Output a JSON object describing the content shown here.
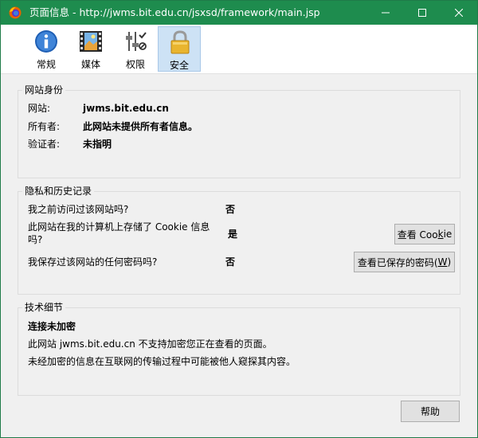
{
  "window": {
    "title": "页面信息 - http://jwms.bit.edu.cn/jsxsd/framework/main.jsp"
  },
  "tabs": [
    {
      "label": "常规",
      "icon": "info-icon"
    },
    {
      "label": "媒体",
      "icon": "media-icon"
    },
    {
      "label": "权限",
      "icon": "permissions-icon"
    },
    {
      "label": "安全",
      "icon": "lock-icon",
      "active": true
    }
  ],
  "identity": {
    "title": "网站身份",
    "site_label": "网站:",
    "site_value": "jwms.bit.edu.cn",
    "owner_label": "所有者:",
    "owner_value": "此网站未提供所有者信息。",
    "verifier_label": "验证者:",
    "verifier_value": "未指明"
  },
  "privacy": {
    "title": "隐私和历史记录",
    "q1": "我之前访问过该网站吗?",
    "a1": "否",
    "q2_line1": "此网站在我的计算机上存储了 Cookie 信息",
    "q2_line2": "吗?",
    "a2": "是",
    "q3": "我保存过该网站的任何密码吗?",
    "a3": "否",
    "cookie_button_text": "查看 Coo",
    "cookie_button_key": "k",
    "cookie_button_rest": "ie",
    "password_button_text": "查看已保存的密码(",
    "password_button_key": "W",
    "password_button_rest": ")"
  },
  "technical": {
    "title": "技术细节",
    "heading": "连接未加密",
    "line1": "此网站 jwms.bit.edu.cn 不支持加密您正在查看的页面。",
    "line2": "未经加密的信息在互联网的传输过程中可能被他人窥探其内容。"
  },
  "footer": {
    "help_label": "帮助"
  },
  "colors": {
    "titlebar": "#1e8c4e",
    "active_tab": "#cde2f5"
  }
}
